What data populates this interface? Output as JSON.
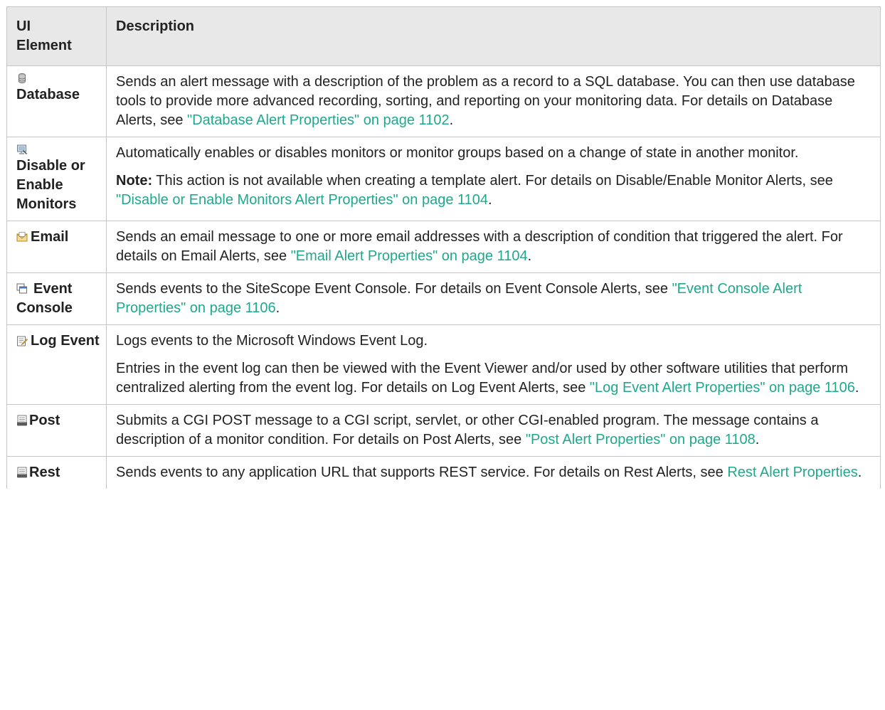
{
  "header": {
    "col1": "UI\nElement",
    "col2": "Description"
  },
  "colors": {
    "link": "#1fa88c",
    "header_bg": "#e8e8e8",
    "border": "#c6c6c6"
  },
  "rows": [
    {
      "icon": "database-icon",
      "name": "Database",
      "paras": [
        {
          "pre": "Sends an alert message with a description of the problem as a record to a SQL database. You can then use database tools to provide more advanced recording, sorting, and reporting on your monitoring data. For details on Database Alerts, see ",
          "link": "\"Database Alert Properties\" on page 1102",
          "post": "."
        }
      ]
    },
    {
      "icon": "monitor-toggle-icon",
      "name": "Disable or Enable Monitors",
      "paras": [
        {
          "pre": "Automatically enables or disables monitors or monitor groups based on a change of state in another monitor.",
          "link": "",
          "post": ""
        },
        {
          "bold": "Note:",
          "pre": " This action is not available when creating a template alert. For details on Disable/Enable Monitor Alerts, see ",
          "link": "\"Disable or Enable Monitors Alert Properties\" on page 1104",
          "post": "."
        }
      ]
    },
    {
      "icon": "email-icon",
      "name": "Email",
      "paras": [
        {
          "pre": "Sends an email message to one or more email addresses with a description of condition that triggered the alert. For details on Email Alerts, see ",
          "link": "\"Email Alert Properties\" on page 1104",
          "post": "."
        }
      ]
    },
    {
      "icon": "event-console-icon",
      "name": "Event Console",
      "paras": [
        {
          "pre": "Sends events to the SiteScope Event Console. For details on Event Console Alerts, see ",
          "link": "\"Event Console Alert Properties\" on page 1106",
          "post": "."
        }
      ]
    },
    {
      "icon": "log-event-icon",
      "name": "Log Event",
      "paras": [
        {
          "pre": "Logs events to the Microsoft Windows Event Log.",
          "link": "",
          "post": ""
        },
        {
          "pre": "Entries in the event log can then be viewed with the Event Viewer and/or used by other software utilities that perform centralized alerting from the event log. For details on Log Event Alerts, see ",
          "link": "\"Log Event Alert Properties\" on page 1106",
          "post": "."
        }
      ]
    },
    {
      "icon": "html-post-icon",
      "name": "Post",
      "paras": [
        {
          "pre": "Submits a CGI POST message to a CGI script, servlet, or other CGI-enabled program. The message contains a description of a monitor condition. For details on Post Alerts, see ",
          "link": "\"Post Alert Properties\" on page 1108",
          "post": "."
        }
      ]
    },
    {
      "icon": "html-rest-icon",
      "name": "Rest",
      "paras": [
        {
          "pre": "Sends events to any application URL that supports REST service. For details on Rest Alerts, see ",
          "link": "Rest Alert Properties",
          "post": "."
        }
      ]
    }
  ]
}
